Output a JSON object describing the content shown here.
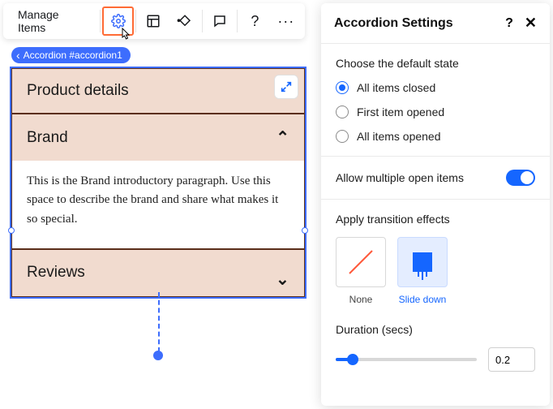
{
  "toolbar": {
    "manage_label": "Manage Items"
  },
  "badge": {
    "label": "Accordion #accordion1"
  },
  "accordion": {
    "items": [
      {
        "title": "Product details"
      },
      {
        "title": "Brand",
        "body": "This is the Brand introductory paragraph. Use this space to describe the brand and share what makes it so special."
      },
      {
        "title": "Reviews"
      }
    ]
  },
  "panel": {
    "title": "Accordion Settings",
    "default_state": {
      "label": "Choose the default state",
      "options": [
        "All items closed",
        "First item opened",
        "All items opened"
      ],
      "selected": 0
    },
    "multi": {
      "label": "Allow multiple open items",
      "on": true
    },
    "effects": {
      "label": "Apply transition effects",
      "options": [
        "None",
        "Slide down"
      ],
      "selected": 1
    },
    "duration": {
      "label": "Duration (secs)",
      "value": "0.2"
    }
  }
}
